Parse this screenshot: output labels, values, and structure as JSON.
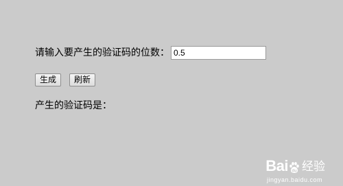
{
  "form": {
    "digits_label": "请输入要产生的验证码的位数：",
    "digits_value": "0.5",
    "generate_label": "生成",
    "refresh_label": "刷新",
    "result_label": "产生的验证码是："
  },
  "watermark": {
    "brand_left": "Bai",
    "brand_right": "经验",
    "url": "jingyan.baidu.com",
    "paw_icon": "baidu-paw-icon"
  }
}
